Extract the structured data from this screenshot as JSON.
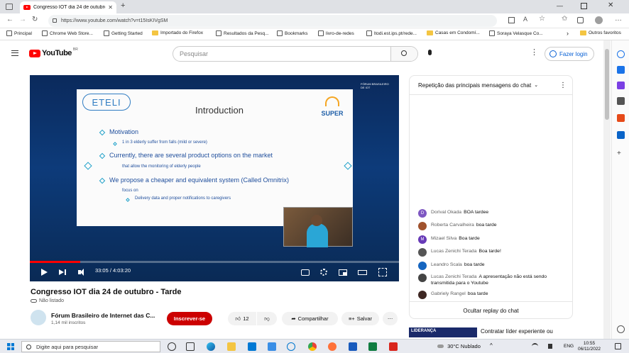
{
  "browser": {
    "tab_title": "Congresso IOT dia 24 de outubro",
    "url": "https://www.youtube.com/watch?v=t15IsKIVgSM",
    "bookmarks": [
      "Principal",
      "Chrome Web Store...",
      "Getting Started",
      "Importado do Firefox",
      "Resultados da Pesq...",
      "Bookmarks",
      "livro-de-redes",
      "ltodi.est.ips.pt/rede...",
      "Casas em Condomí...",
      "Soraya Velasque Co...",
      "Outros favoritos"
    ]
  },
  "header": {
    "logo_text": "YouTube",
    "country": "BR",
    "search_placeholder": "Pesquisar",
    "login_label": "Fazer login"
  },
  "video": {
    "slide": {
      "logo": "ETELI",
      "logo2": "SUPER",
      "title": "Introduction",
      "bullets": [
        "Motivation",
        "1 in 3 elderly suffer from falls (mild or severe)",
        "Currently, there are several product options on the market",
        "that allow the monitoring of elderly people",
        "We propose a cheaper and equivalent system (Called Omnitrix)",
        "focus on",
        "Delivery data and proper notifications to caregivers"
      ],
      "corner_brand": "FÓRUM BRASILEIRO DE IOT"
    },
    "time": "33:05 / 4:03:20",
    "progress": 0.136,
    "title": "Congresso IOT dia 24 de outubro - Tarde",
    "visibility": "Não listado"
  },
  "channel": {
    "name": "Fórum Brasileiro de Internet das C...",
    "subscribers": "1,14 mil inscritos",
    "subscribe_label": "Inscrever-se",
    "likes": "12",
    "share_label": "Compartilhar",
    "save_label": "Salvar"
  },
  "chat": {
    "header": "Repetição das principais mensagens do chat",
    "messages": [
      {
        "initial": "D",
        "color": "#7e57c2",
        "author": "Dorival Okada",
        "text": "BOA tardee"
      },
      {
        "initial": "",
        "color": "#a0522d",
        "author": "Roberta Carvalheira",
        "text": "boa tarde"
      },
      {
        "initial": "M",
        "color": "#673ab7",
        "author": "Mizael Silva",
        "text": "Boa tarde"
      },
      {
        "initial": "",
        "color": "#555555",
        "author": "Lucas Zenichi Terada",
        "text": "Boa tarde!"
      },
      {
        "initial": "",
        "color": "#1565c0",
        "author": "Leandro Scala",
        "text": "boa tarde"
      },
      {
        "initial": "",
        "color": "#444444",
        "author": "Lucas Zenichi Terada",
        "text": "A apresentação não está sendo transmitida para o Youtube"
      },
      {
        "initial": "",
        "color": "#3e2723",
        "author": "Gabriely Rangel",
        "text": "boa tarde"
      }
    ],
    "footer": "Ocultar replay do chat"
  },
  "ad": {
    "thumb_text": "LIDERANÇA",
    "title": "Contratar líder experiente ou"
  },
  "taskbar": {
    "search_placeholder": "Digite aqui para pesquisar",
    "weather": "30°C  Nublado",
    "lang": "ENG",
    "time": "10:55",
    "date": "06/11/2022"
  },
  "colors": {
    "yt_red": "#ff0000",
    "subscribe": "#cc0000",
    "link_blue": "#065fd4"
  }
}
